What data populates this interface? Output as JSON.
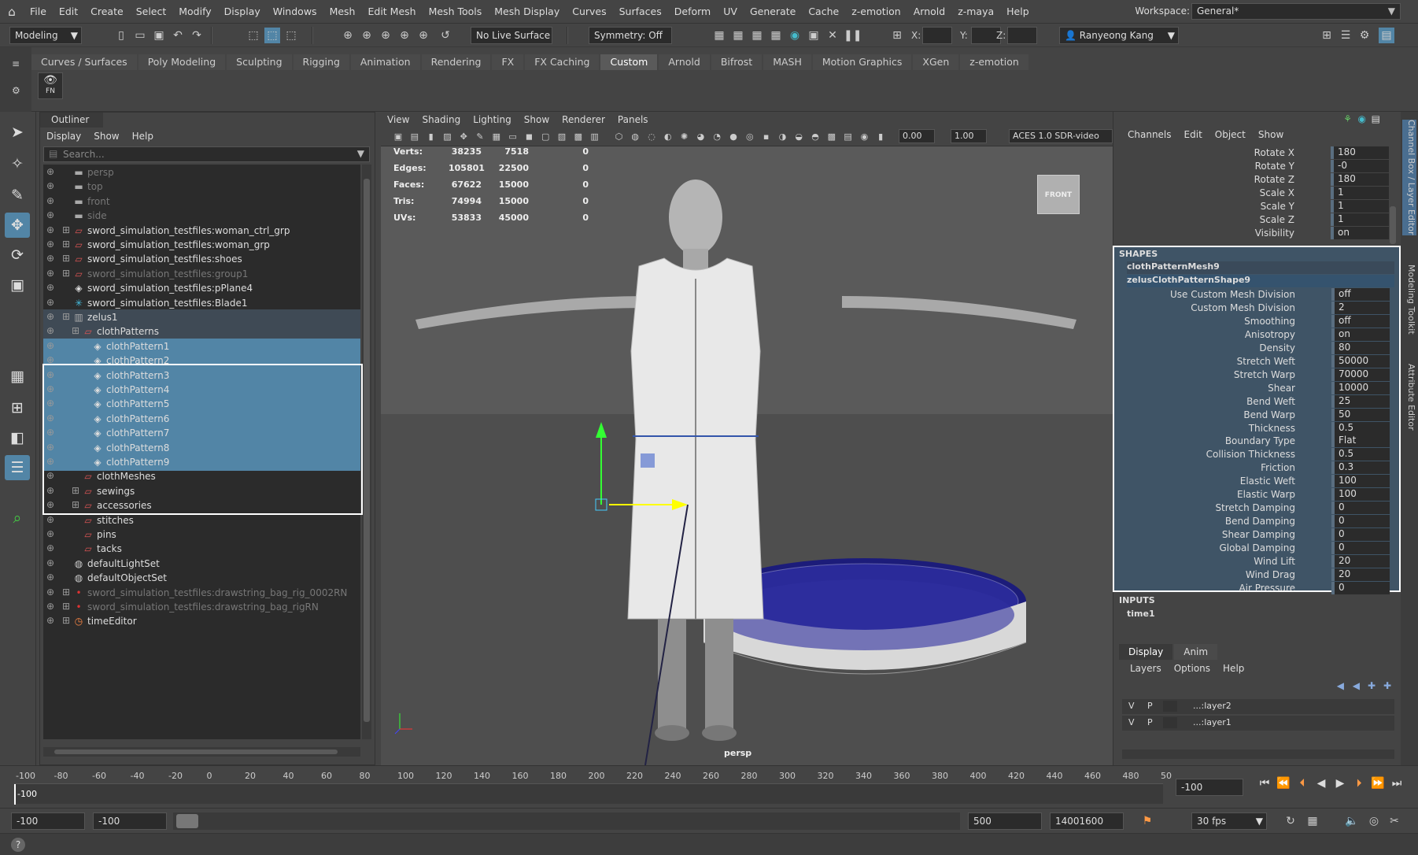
{
  "menubar": {
    "items": [
      "File",
      "Edit",
      "Create",
      "Select",
      "Modify",
      "Display",
      "Windows",
      "Mesh",
      "Edit Mesh",
      "Mesh Tools",
      "Mesh Display",
      "Curves",
      "Surfaces",
      "Deform",
      "UV",
      "Generate",
      "Cache",
      "z-emotion",
      "Arnold",
      "z-maya",
      "Help"
    ],
    "workspace_label": "Workspace:",
    "workspace_value": "General*"
  },
  "statusline": {
    "mode": "Modeling",
    "live_surface": "No Live Surface",
    "symmetry": "Symmetry: Off",
    "x_label": "X:",
    "y_label": "Y:",
    "z_label": "Z:",
    "user": "Ranyeong Kang"
  },
  "shelf": {
    "tabs": [
      "Curves / Surfaces",
      "Poly Modeling",
      "Sculpting",
      "Rigging",
      "Animation",
      "Rendering",
      "FX",
      "FX Caching",
      "Custom",
      "Arnold",
      "Bifrost",
      "MASH",
      "Motion Graphics",
      "XGen",
      "z-emotion"
    ],
    "active_tab": "Custom",
    "button_label": "FN"
  },
  "outliner": {
    "title": "Outliner",
    "menu": [
      "Display",
      "Show",
      "Help"
    ],
    "search_placeholder": "Search...",
    "rows": [
      {
        "label": "persp",
        "indent": 0,
        "icon": "camera",
        "dim": true,
        "plus": false
      },
      {
        "label": "top",
        "indent": 0,
        "icon": "camera",
        "dim": true,
        "plus": false
      },
      {
        "label": "front",
        "indent": 0,
        "icon": "camera",
        "dim": true,
        "plus": false
      },
      {
        "label": "side",
        "indent": 0,
        "icon": "camera",
        "dim": true,
        "plus": false
      },
      {
        "label": "sword_simulation_testfiles:woman_ctrl_grp",
        "indent": 0,
        "icon": "group",
        "dim": false,
        "plus": true
      },
      {
        "label": "sword_simulation_testfiles:woman_grp",
        "indent": 0,
        "icon": "group",
        "dim": false,
        "plus": true
      },
      {
        "label": "sword_simulation_testfiles:shoes",
        "indent": 0,
        "icon": "group",
        "dim": false,
        "plus": true
      },
      {
        "label": "sword_simulation_testfiles:group1",
        "indent": 0,
        "icon": "group",
        "dim": true,
        "plus": true
      },
      {
        "label": "sword_simulation_testfiles:pPlane4",
        "indent": 0,
        "icon": "mesh",
        "dim": false,
        "plus": false
      },
      {
        "label": "sword_simulation_testfiles:Blade1",
        "indent": 0,
        "icon": "joint",
        "dim": false,
        "plus": false
      },
      {
        "label": "zelus1",
        "indent": 0,
        "icon": "zelus",
        "dim": false,
        "plus": true,
        "par": true
      },
      {
        "label": "clothPatterns",
        "indent": 1,
        "icon": "group",
        "dim": false,
        "plus": true,
        "par": true
      },
      {
        "label": "clothPattern1",
        "indent": 2,
        "icon": "mesh",
        "dim": false,
        "plus": false,
        "hl": true
      },
      {
        "label": "clothPattern2",
        "indent": 2,
        "icon": "mesh",
        "dim": false,
        "plus": false,
        "hl": true
      },
      {
        "label": "clothPattern3",
        "indent": 2,
        "icon": "mesh",
        "dim": false,
        "plus": false,
        "hl": true
      },
      {
        "label": "clothPattern4",
        "indent": 2,
        "icon": "mesh",
        "dim": false,
        "plus": false,
        "hl": true
      },
      {
        "label": "clothPattern5",
        "indent": 2,
        "icon": "mesh",
        "dim": false,
        "plus": false,
        "hl": true
      },
      {
        "label": "clothPattern6",
        "indent": 2,
        "icon": "mesh",
        "dim": false,
        "plus": false,
        "hl": true
      },
      {
        "label": "clothPattern7",
        "indent": 2,
        "icon": "mesh",
        "dim": false,
        "plus": false,
        "hl": true
      },
      {
        "label": "clothPattern8",
        "indent": 2,
        "icon": "mesh",
        "dim": false,
        "plus": false,
        "hl": true
      },
      {
        "label": "clothPattern9",
        "indent": 2,
        "icon": "mesh",
        "dim": false,
        "plus": false,
        "hl": true
      },
      {
        "label": "clothMeshes",
        "indent": 1,
        "icon": "group",
        "dim": false,
        "plus": false
      },
      {
        "label": "sewings",
        "indent": 1,
        "icon": "group",
        "dim": false,
        "plus": true
      },
      {
        "label": "accessories",
        "indent": 1,
        "icon": "group",
        "dim": false,
        "plus": true
      },
      {
        "label": "stitches",
        "indent": 1,
        "icon": "group",
        "dim": false,
        "plus": false
      },
      {
        "label": "pins",
        "indent": 1,
        "icon": "group",
        "dim": false,
        "plus": false
      },
      {
        "label": "tacks",
        "indent": 1,
        "icon": "group",
        "dim": false,
        "plus": false
      },
      {
        "label": "defaultLightSet",
        "indent": 0,
        "icon": "set",
        "dim": false,
        "plus": false
      },
      {
        "label": "defaultObjectSet",
        "indent": 0,
        "icon": "set",
        "dim": false,
        "plus": false
      },
      {
        "label": "sword_simulation_testfiles:drawstring_bag_rig_0002RN",
        "indent": 0,
        "icon": "ref",
        "dim": true,
        "plus": true
      },
      {
        "label": "sword_simulation_testfiles:drawstring_bag_rigRN",
        "indent": 0,
        "icon": "ref",
        "dim": true,
        "plus": true
      },
      {
        "label": "timeEditor",
        "indent": 0,
        "icon": "time",
        "dim": false,
        "plus": true
      }
    ]
  },
  "viewport": {
    "menu": [
      "View",
      "Shading",
      "Lighting",
      "Show",
      "Renderer",
      "Panels"
    ],
    "field1": "0.00",
    "field2": "1.00",
    "colorspace": "ACES 1.0 SDR-video",
    "hud": [
      {
        "label": "Verts:",
        "a": "38235",
        "b": "7518",
        "c": "0"
      },
      {
        "label": "Edges:",
        "a": "105801",
        "b": "22500",
        "c": "0"
      },
      {
        "label": "Faces:",
        "a": "67622",
        "b": "15000",
        "c": "0"
      },
      {
        "label": "Tris:",
        "a": "74994",
        "b": "15000",
        "c": "0"
      },
      {
        "label": "UVs:",
        "a": "53833",
        "b": "45000",
        "c": "0"
      }
    ],
    "view_cube": "FRONT",
    "camera": "persp"
  },
  "channelbox": {
    "menu": [
      "Channels",
      "Edit",
      "Object",
      "Show"
    ],
    "transform": [
      {
        "name": "Rotate X",
        "value": "180"
      },
      {
        "name": "Rotate Y",
        "value": "-0"
      },
      {
        "name": "Rotate Z",
        "value": "180"
      },
      {
        "name": "Scale X",
        "value": "1"
      },
      {
        "name": "Scale Y",
        "value": "1"
      },
      {
        "name": "Scale Z",
        "value": "1"
      },
      {
        "name": "Visibility",
        "value": "on"
      }
    ],
    "shapes_header": "SHAPES",
    "shape1": "clothPatternMesh9",
    "shape2": "zelusClothPatternShape9",
    "shape_attrs": [
      {
        "name": "Use Custom Mesh Division",
        "value": "off"
      },
      {
        "name": "Custom Mesh Division",
        "value": "2"
      },
      {
        "name": "Smoothing",
        "value": "off"
      },
      {
        "name": "Anisotropy",
        "value": "on"
      },
      {
        "name": "Density",
        "value": "80"
      },
      {
        "name": "Stretch Weft",
        "value": "50000"
      },
      {
        "name": "Stretch Warp",
        "value": "70000"
      },
      {
        "name": "Shear",
        "value": "10000"
      },
      {
        "name": "Bend Weft",
        "value": "25"
      },
      {
        "name": "Bend Warp",
        "value": "50"
      },
      {
        "name": "Thickness",
        "value": "0.5"
      },
      {
        "name": "Boundary Type",
        "value": "Flat"
      },
      {
        "name": "Collision Thickness",
        "value": "0.5"
      },
      {
        "name": "Friction",
        "value": "0.3"
      },
      {
        "name": "Elastic Weft",
        "value": "100"
      },
      {
        "name": "Elastic Warp",
        "value": "100"
      },
      {
        "name": "Stretch Damping",
        "value": "0"
      },
      {
        "name": "Bend Damping",
        "value": "0"
      },
      {
        "name": "Shear Damping",
        "value": "0"
      },
      {
        "name": "Global Damping",
        "value": "0"
      },
      {
        "name": "Wind Lift",
        "value": "20"
      },
      {
        "name": "Wind Drag",
        "value": "20"
      },
      {
        "name": "Air Pressure",
        "value": "0"
      }
    ],
    "inputs_header": "INPUTS",
    "input1": "time1",
    "side_tabs": [
      "Channel Box / Layer Editor",
      "Modeling Toolkit",
      "Attribute Editor"
    ]
  },
  "layers": {
    "tabs": [
      "Display",
      "Anim"
    ],
    "menu": [
      "Layers",
      "Options",
      "Help"
    ],
    "rows": [
      {
        "v": "V",
        "p": "P",
        "name": "...:layer2"
      },
      {
        "v": "V",
        "p": "P",
        "name": "...:layer1"
      }
    ]
  },
  "timeline": {
    "ticks": [
      "-100",
      "-80",
      "-60",
      "-40",
      "-20",
      "0",
      "20",
      "40",
      "60",
      "80",
      "100",
      "120",
      "140",
      "160",
      "180",
      "200",
      "220",
      "240",
      "260",
      "280",
      "300",
      "320",
      "340",
      "360",
      "380",
      "400",
      "420",
      "440",
      "460",
      "480",
      "50"
    ],
    "current_frame_left": "-100",
    "current_frame_field": "-100"
  },
  "range": {
    "start": "-100",
    "playback_start": "-100",
    "playback_end": "500",
    "end": "14001600",
    "fps": "30 fps"
  }
}
